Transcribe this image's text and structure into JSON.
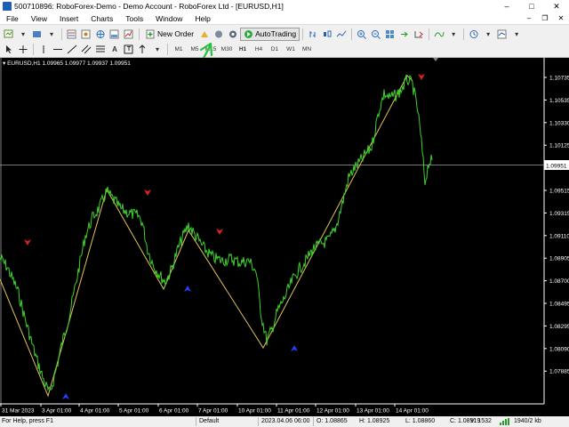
{
  "window": {
    "title": "50071089​6: RoboForex-Demo - Demo Account - RoboForex Ltd - [EURUSD,H1]",
    "controls": [
      "–",
      "□",
      "✕"
    ]
  },
  "menu": {
    "items": [
      "File",
      "View",
      "Insert",
      "Charts",
      "Tools",
      "Window",
      "Help"
    ],
    "mdi_controls": [
      "–",
      "❐",
      "✕"
    ]
  },
  "toolbar": {
    "new_order_label": "New Order",
    "autotrading_label": "AutoTrading",
    "timeframes": [
      "M1",
      "M5",
      "M15",
      "M30",
      "H1",
      "H4",
      "D1",
      "W1",
      "MN"
    ],
    "active_timeframe": "H1",
    "text_tool_label": "A",
    "text_label_tool_label": "T"
  },
  "chart": {
    "symbol_line": "EURUSD,H1  1.09965 1.09977 1.09937 1.09951",
    "current_price_label": "1.09951",
    "price_axis_labels": [
      "1.10735",
      "1.10535",
      "1.10330",
      "1.10125",
      "1.09720",
      "1.09515",
      "1.09315",
      "1.09110",
      "1.08905",
      "1.08700",
      "1.08495",
      "1.08295",
      "1.08090",
      "1.07885"
    ],
    "time_axis_labels": [
      "31 Mar 2023",
      "3 Apr 01:00",
      "4 Apr 01:00",
      "5 Apr 01:00",
      "6 Apr 01:00",
      "7 Apr 01:00",
      "10 Apr 01:00",
      "11 Apr 01:00",
      "12 Apr 01:00",
      "13 Apr 01:00",
      "14 Apr 01:00"
    ],
    "colors": {
      "background": "#000000",
      "price_line": "#3cd22d",
      "zigzag": "#e0c45a",
      "up_arrow": "#2a3cff",
      "down_arrow": "#e02020",
      "axis_text": "#ffffff",
      "grid": "#808080"
    }
  },
  "status": {
    "help": "For Help, press F1",
    "profile": "Default",
    "time": "2023.04.06 06:00",
    "open": "O: 1.08865",
    "high": "H: 1.08925",
    "low": "L: 1.08860",
    "close": "C: 1.08919",
    "volume": "V: 1532",
    "traffic": "1940/2 kb"
  }
}
